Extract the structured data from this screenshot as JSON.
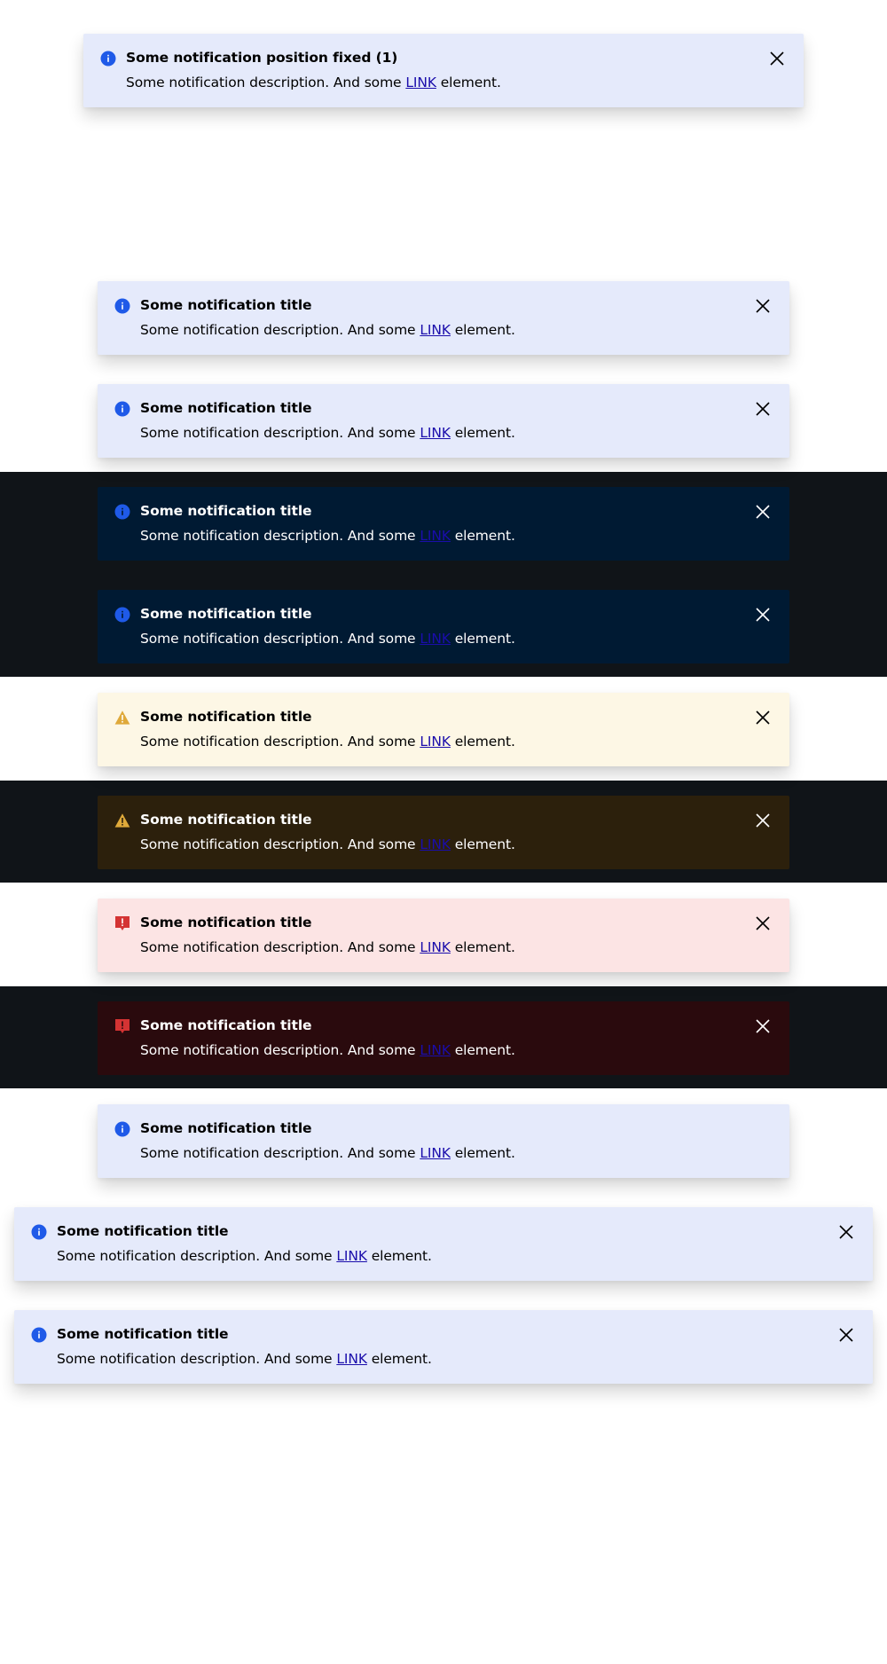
{
  "link_label": "LINK",
  "desc_before": "Some notification description. And some ",
  "desc_after": " element.",
  "colors": {
    "info_icon": "#1f5ae8",
    "warning_icon": "#dfa93a",
    "error_icon": "#d43333",
    "dark_band": "#101418"
  },
  "notifications": [
    {
      "title": "Some notification position fixed (1)",
      "variant": "info",
      "theme": "light",
      "icon": "info-icon",
      "closable": true
    },
    {
      "title": "Some notification title",
      "variant": "info",
      "theme": "light",
      "icon": "info-icon",
      "closable": true
    },
    {
      "title": "Some notification title",
      "variant": "info",
      "theme": "light",
      "icon": "info-icon",
      "closable": true
    },
    {
      "title": "Some notification title",
      "variant": "info",
      "theme": "dark",
      "icon": "info-icon",
      "closable": true
    },
    {
      "title": "Some notification title",
      "variant": "info",
      "theme": "dark",
      "icon": "info-icon",
      "closable": true
    },
    {
      "title": "Some notification title",
      "variant": "warning",
      "theme": "light",
      "icon": "warning-icon",
      "closable": true
    },
    {
      "title": "Some notification title",
      "variant": "warning",
      "theme": "dark",
      "icon": "warning-icon",
      "closable": true
    },
    {
      "title": "Some notification title",
      "variant": "error",
      "theme": "light",
      "icon": "error-icon",
      "closable": true
    },
    {
      "title": "Some notification title",
      "variant": "error",
      "theme": "dark",
      "icon": "error-icon",
      "closable": true
    },
    {
      "title": "Some notification title",
      "variant": "info",
      "theme": "light",
      "icon": "info-icon",
      "closable": false
    },
    {
      "title": "Some notification title",
      "variant": "info",
      "theme": "light",
      "icon": "info-icon",
      "closable": true
    },
    {
      "title": "Some notification title",
      "variant": "info",
      "theme": "light",
      "icon": "info-icon",
      "closable": true
    }
  ]
}
